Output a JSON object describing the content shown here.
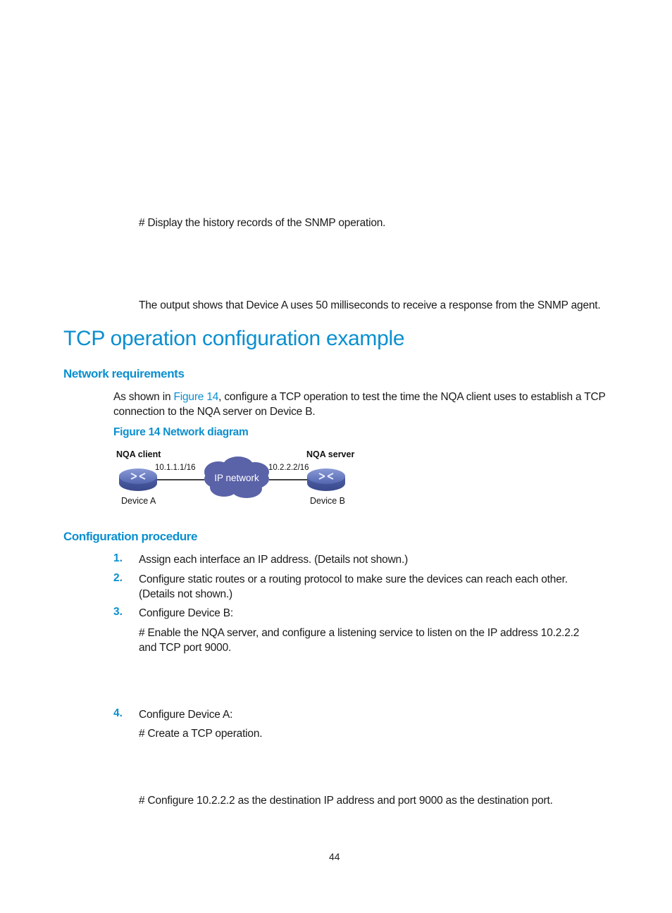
{
  "top_text": {
    "display_history": "# Display the history records of the SNMP operation.",
    "output_note": "The output shows that Device A uses 50 milliseconds to receive a response from the SNMP agent."
  },
  "section": {
    "title": "TCP operation configuration example"
  },
  "network_requirements": {
    "heading": "Network requirements",
    "para_prefix": "As shown in ",
    "para_link": "Figure 14",
    "para_suffix_line1": ", configure a TCP operation to test the time the NQA client uses to establish a TCP",
    "para_line2": "connection to the NQA server on Device B.",
    "figure_caption": "Figure 14 Network diagram"
  },
  "diagram": {
    "client_role": "NQA client",
    "server_role": "NQA server",
    "client_ip": "10.1.1.1/16",
    "server_ip": "10.2.2.2/16",
    "cloud_label": "IP network",
    "device_a": "Device A",
    "device_b": "Device B",
    "colors": {
      "cloud": "#5a62a8",
      "router": "#6a7fc0"
    }
  },
  "configuration_procedure": {
    "heading": "Configuration procedure",
    "steps": [
      {
        "num": "1.",
        "lines": [
          "Assign each interface an IP address. (Details not shown.)"
        ]
      },
      {
        "num": "2.",
        "lines": [
          "Configure static routes or a routing protocol to make sure the devices can reach each other.",
          "(Details not shown.)"
        ]
      },
      {
        "num": "3.",
        "lines": [
          "Configure Device B:"
        ],
        "sub": [
          "# Enable the NQA server, and configure a listening service to listen on the IP address 10.2.2.2",
          "and TCP port 9000."
        ]
      },
      {
        "num": "4.",
        "lines": [
          "Configure Device A:"
        ],
        "sub": [
          "# Create a TCP operation."
        ],
        "sub2": [
          "# Configure 10.2.2.2 as the destination IP address and port 9000 as the destination port."
        ]
      }
    ]
  },
  "footer": {
    "page_number": "44"
  },
  "colors": {
    "accent": "#0a8fcf",
    "text": "#1a1a1a"
  }
}
